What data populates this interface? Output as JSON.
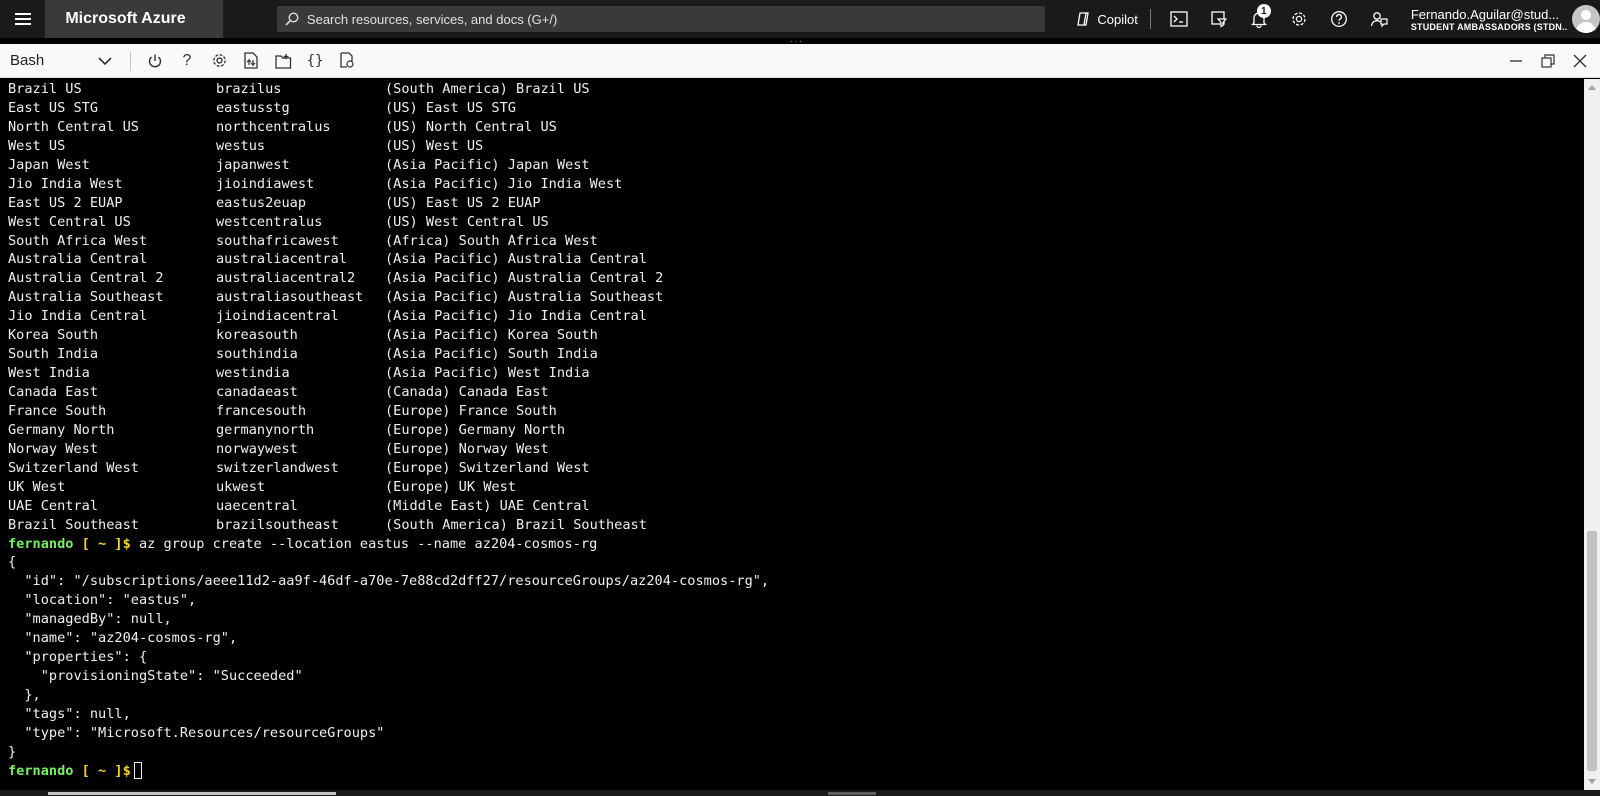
{
  "topbar": {
    "brand": "Microsoft Azure",
    "search_placeholder": "Search resources, services, and docs (G+/)",
    "copilot_label": "Copilot",
    "notification_count": "1",
    "account_name": "Fernando.Aguilar@stud...",
    "account_directory": "STUDENT AMBASSADORS (STDN..."
  },
  "shell": {
    "selected": "Bash"
  },
  "terminal": {
    "regions": [
      [
        "Brazil US",
        "brazilus",
        "(South America) Brazil US"
      ],
      [
        "East US STG",
        "eastusstg",
        "(US) East US STG"
      ],
      [
        "North Central US",
        "northcentralus",
        "(US) North Central US"
      ],
      [
        "West US",
        "westus",
        "(US) West US"
      ],
      [
        "Japan West",
        "japanwest",
        "(Asia Pacific) Japan West"
      ],
      [
        "Jio India West",
        "jioindiawest",
        "(Asia Pacific) Jio India West"
      ],
      [
        "East US 2 EUAP",
        "eastus2euap",
        "(US) East US 2 EUAP"
      ],
      [
        "West Central US",
        "westcentralus",
        "(US) West Central US"
      ],
      [
        "South Africa West",
        "southafricawest",
        "(Africa) South Africa West"
      ],
      [
        "Australia Central",
        "australiacentral",
        "(Asia Pacific) Australia Central"
      ],
      [
        "Australia Central 2",
        "australiacentral2",
        "(Asia Pacific) Australia Central 2"
      ],
      [
        "Australia Southeast",
        "australiasoutheast",
        "(Asia Pacific) Australia Southeast"
      ],
      [
        "Jio India Central",
        "jioindiacentral",
        "(Asia Pacific) Jio India Central"
      ],
      [
        "Korea South",
        "koreasouth",
        "(Asia Pacific) Korea South"
      ],
      [
        "South India",
        "southindia",
        "(Asia Pacific) South India"
      ],
      [
        "West India",
        "westindia",
        "(Asia Pacific) West India"
      ],
      [
        "Canada East",
        "canadaeast",
        "(Canada) Canada East"
      ],
      [
        "France South",
        "francesouth",
        "(Europe) France South"
      ],
      [
        "Germany North",
        "germanynorth",
        "(Europe) Germany North"
      ],
      [
        "Norway West",
        "norwaywest",
        "(Europe) Norway West"
      ],
      [
        "Switzerland West",
        "switzerlandwest",
        "(Europe) Switzerland West"
      ],
      [
        "UK West",
        "ukwest",
        "(Europe) UK West"
      ],
      [
        "UAE Central",
        "uaecentral",
        "(Middle East) UAE Central"
      ],
      [
        "Brazil Southeast",
        "brazilsoutheast",
        "(South America) Brazil Southeast"
      ]
    ],
    "prompt_user": "fernando",
    "prompt_rest": " [ ~ ]$",
    "command": " az group create --location eastus --name az204-cosmos-rg",
    "json_output": [
      "{",
      "  \"id\": \"/subscriptions/aeee11d2-aa9f-46df-a70e-7e88cd2dff27/resourceGroups/az204-cosmos-rg\",",
      "  \"location\": \"eastus\",",
      "  \"managedBy\": null,",
      "  \"name\": \"az204-cosmos-rg\",",
      "  \"properties\": {",
      "    \"provisioningState\": \"Succeeded\"",
      "  },",
      "  \"tags\": null,",
      "  \"type\": \"Microsoft.Resources/resourceGroups\"",
      "}"
    ]
  },
  "colors": {
    "topbar_bg": "#1b1a19",
    "brand_bg": "#3b3a39",
    "prompt_user": "#74f060",
    "prompt_path": "#f0d22a",
    "terminal_bg": "#000000"
  }
}
